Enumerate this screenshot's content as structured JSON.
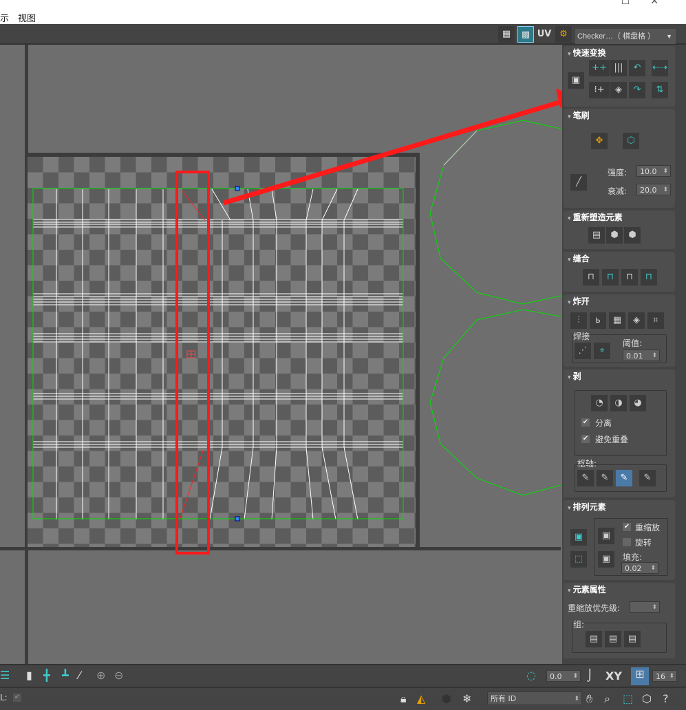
{
  "menu": {
    "items": [
      "示",
      "视图"
    ]
  },
  "window_controls": {
    "maximize": "☐",
    "close": "✕"
  },
  "toolbar": {
    "uv_label": "UV",
    "checker_dropdown": "Checker…（ 棋盘格 ）"
  },
  "panel": {
    "quick_transform": {
      "title": "快速变换"
    },
    "brush": {
      "title": "笔刷",
      "strength_label": "强度:",
      "strength_value": "10.0",
      "falloff_label": "衰减:",
      "falloff_value": "20.0"
    },
    "reshape": {
      "title": "重新塑造元素"
    },
    "stitch": {
      "title": "缝合"
    },
    "explode": {
      "title": "炸开",
      "weld_label": "焊接",
      "threshold_label": "阈值:",
      "threshold_value": "0.01"
    },
    "peel": {
      "title": "剥",
      "detach_label": "分离",
      "detach_checked": true,
      "avoid_overlap_label": "避免重叠",
      "avoid_overlap_checked": true,
      "pivot_label": "枢轴:"
    },
    "arrange": {
      "title": "排列元素",
      "rescale_label": "重缩放",
      "rescale_checked": true,
      "rotate_label": "旋转",
      "rotate_checked": false,
      "padding_label": "填充:",
      "padding_value": "0.02"
    },
    "element_props": {
      "title": "元素属性",
      "rescale_priority_label": "重缩放优先级:",
      "group_label": "组:"
    }
  },
  "bottom": {
    "angle_value": "0.0",
    "xy_label": "XY",
    "grid_value": "16"
  },
  "status": {
    "left_label": "L:",
    "id_dropdown": "所有 ID"
  },
  "colors": {
    "accent": "#40c8c8",
    "highlight": "#ff1a1a",
    "uv_boundary": "#00e000"
  }
}
